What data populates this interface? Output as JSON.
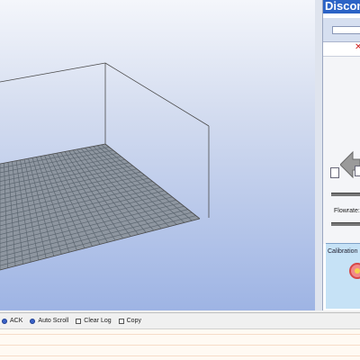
{
  "connection": {
    "title": "Discon",
    "port_value": "",
    "disconnect_icon": "red-x-icon"
  },
  "viewer": {
    "grid_color": "#5c6670",
    "box_color": "#4a4a4a",
    "background_top": "#f4f6fb",
    "background_bottom": "#9eb4e4"
  },
  "controls": {
    "flowrate_label": "Flowrate:",
    "calibration_label": "Calibration",
    "move_arrow_icon": "left-arrow-icon"
  },
  "toolbar": {
    "ack_label": "ACK",
    "autoscroll_label": "Auto Scroll",
    "clearlog_label": "Clear Log",
    "copy_label": "Copy"
  }
}
